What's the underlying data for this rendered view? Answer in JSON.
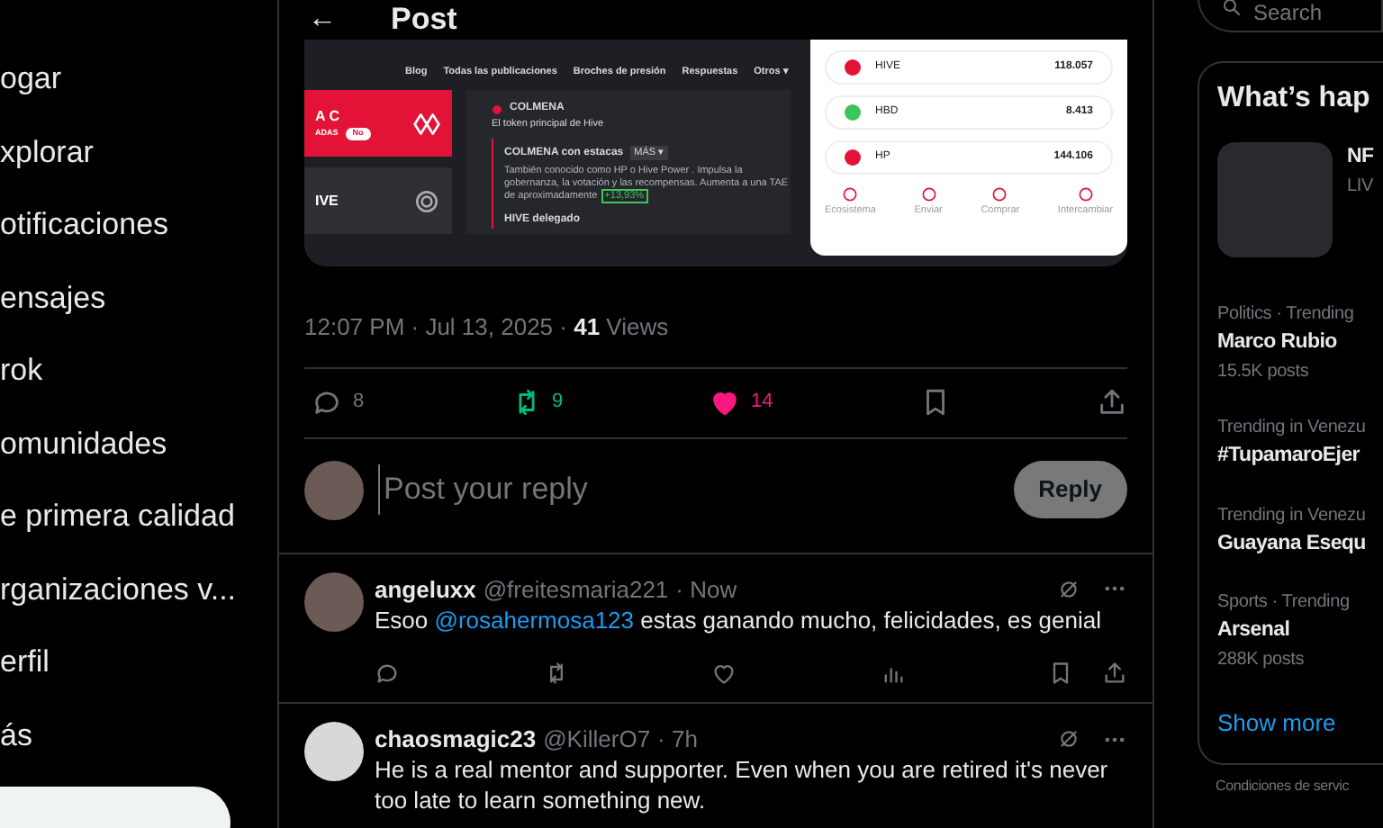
{
  "sidebar": {
    "items": [
      {
        "label": "ogar"
      },
      {
        "label": "xplorar"
      },
      {
        "label": "otificaciones"
      },
      {
        "label": "ensajes"
      },
      {
        "label": "rok"
      },
      {
        "label": "omunidades"
      },
      {
        "label": "e primera calidad"
      },
      {
        "label": "rganizaciones v..."
      },
      {
        "label": "erfil"
      },
      {
        "label": "ás"
      }
    ]
  },
  "post": {
    "header": {
      "back": "←",
      "title": "Post"
    },
    "embedded_screenshot": {
      "nav": [
        "Blog",
        "Todas las publicaciones",
        "Broches de presión",
        "Respuestas",
        "Otros ▾"
      ],
      "left_cards": [
        {
          "kind": "red",
          "label": "A C",
          "toggle_label": "ADAS",
          "toggle": "No",
          "toggle_on": false
        },
        {
          "kind": "dark",
          "label": "IVE"
        }
      ],
      "token": {
        "name": "COLMENA",
        "desc": "El token principal de Hive",
        "staked": "COLMENA con estacas",
        "more": "MÁS ▾",
        "staked_desc": "También conocido como HP o Hive Power . Impulsa la gobernanza, la votación y las recompensas. Aumenta a una TAE de aproximadamente",
        "apr": "+13,93%",
        "delegated": "HIVE delegado"
      },
      "wallet": {
        "balances": [
          {
            "name": "HIVE",
            "amount": "118.057",
            "color": "#e31337"
          },
          {
            "name": "HBD",
            "amount": "8.413",
            "color": "#3ec55a"
          },
          {
            "name": "HP",
            "amount": "144.106",
            "color": "#e31337"
          }
        ],
        "actions": [
          "Ecosistema",
          "Enviar",
          "Comprar",
          "Intercambiar"
        ]
      }
    },
    "timestamp": "12:07 PM · Jul 13, 2025 · ",
    "views_count": "41",
    "views_label": "Views",
    "actions": [
      {
        "kind": "reply",
        "count": "8"
      },
      {
        "kind": "repost",
        "count": "9",
        "active": true
      },
      {
        "kind": "like",
        "count": "14",
        "active": true
      },
      {
        "kind": "bookmark"
      },
      {
        "kind": "share"
      }
    ]
  },
  "composer": {
    "placeholder": "Post your reply",
    "button": "Reply"
  },
  "replies": [
    {
      "name": "angeluxx",
      "handle": "@freitesmaria221",
      "time": "· Now",
      "text": [
        {
          "kind": "text",
          "t": "Esoo "
        },
        {
          "kind": "mention",
          "t": "@rosahermosa123"
        },
        {
          "kind": "text",
          "t": "  estas ganando mucho, felicidades, es genial"
        }
      ],
      "show_actions": true
    },
    {
      "name": "chaosmagic23",
      "handle": "@KillerO7",
      "time": "· 7h",
      "text": [
        {
          "kind": "text",
          "t": "He is a real mentor and supporter. Even when you are retired it's never too late to learn something new."
        }
      ],
      "show_actions": false
    }
  ],
  "right": {
    "search_placeholder": "Search",
    "trends_title": "What’s hap",
    "featured": {
      "title": "NF",
      "subtitle": "LIV"
    },
    "trends": [
      {
        "meta": "Politics · Trending",
        "title": "Marco Rubio",
        "posts": "15.5K posts"
      },
      {
        "meta": "Trending in Venezu",
        "title": "#TupamaroEjer"
      },
      {
        "meta": "Trending in Venezu",
        "title": "Guayana Esequ"
      },
      {
        "meta": "Sports · Trending",
        "title": "Arsenal",
        "posts": "288K posts"
      }
    ],
    "show_more": "Show more",
    "footer": "Condiciones de servic"
  }
}
